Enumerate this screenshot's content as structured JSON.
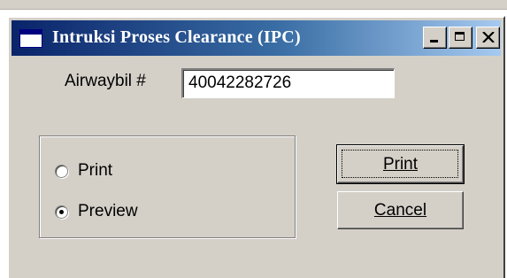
{
  "window": {
    "title": "Intruksi Proses Clearance (IPC)"
  },
  "form": {
    "airwaybill_label": "Airwaybil #",
    "airwaybill_value": "40042282726"
  },
  "output_options": [
    {
      "label": "Print",
      "checked": false
    },
    {
      "label": "Preview",
      "checked": true
    }
  ],
  "buttons": {
    "print_label": "Print",
    "cancel_label": "Cancel"
  },
  "icons": {
    "app": "window-app-icon",
    "minimize": "minimize-icon",
    "maximize": "maximize-icon",
    "close": "close-icon"
  },
  "colors": {
    "titlebar_start": "#0a246a",
    "titlebar_end": "#a6caf0",
    "face": "#d4d0c8"
  }
}
